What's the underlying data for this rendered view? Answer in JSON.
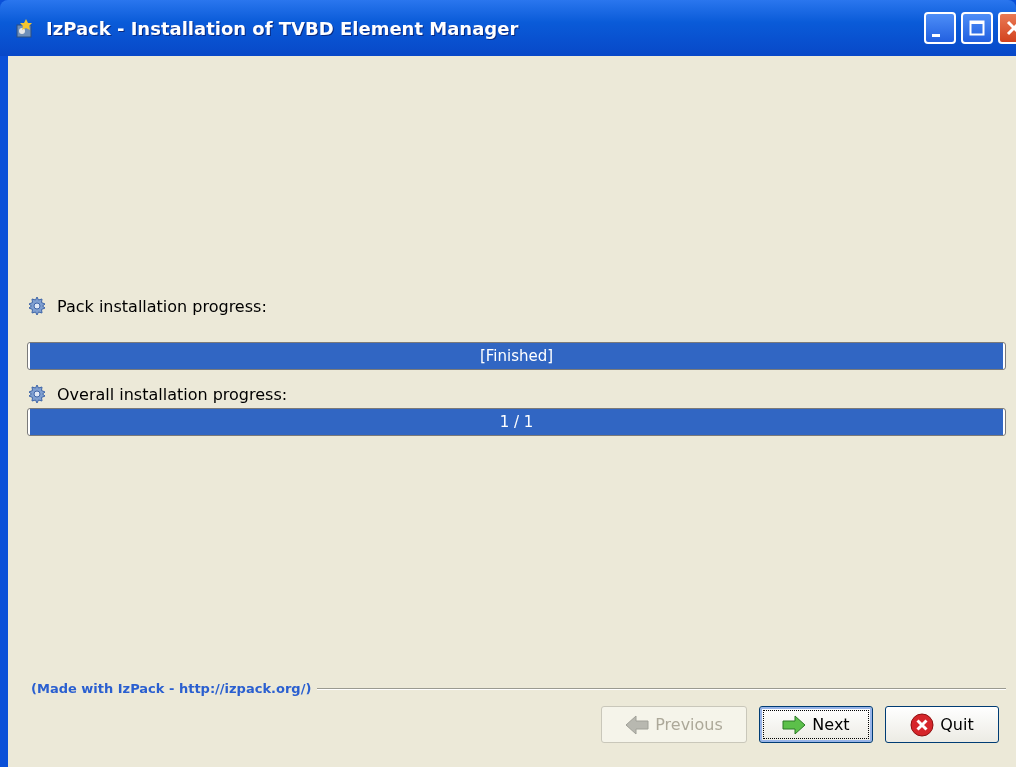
{
  "window": {
    "title": "IzPack - Installation of TVBD Element Manager"
  },
  "progress": [
    {
      "label": "Pack installation progress:",
      "level": 1,
      "reading": "[Finished]"
    },
    {
      "label": "Overall installation progress:",
      "level": 1,
      "reading": "1 / 1"
    }
  ],
  "footer": {
    "credit": "(Made with IzPack - http://izpack.org/)"
  },
  "buttons": [
    {
      "kind": "previous",
      "label": "Previous",
      "disabled": true,
      "focused": false
    },
    {
      "kind": "next",
      "label": "Next",
      "disabled": false,
      "focused": true
    },
    {
      "kind": "quit",
      "label": "Quit",
      "disabled": false,
      "focused": false
    }
  ]
}
